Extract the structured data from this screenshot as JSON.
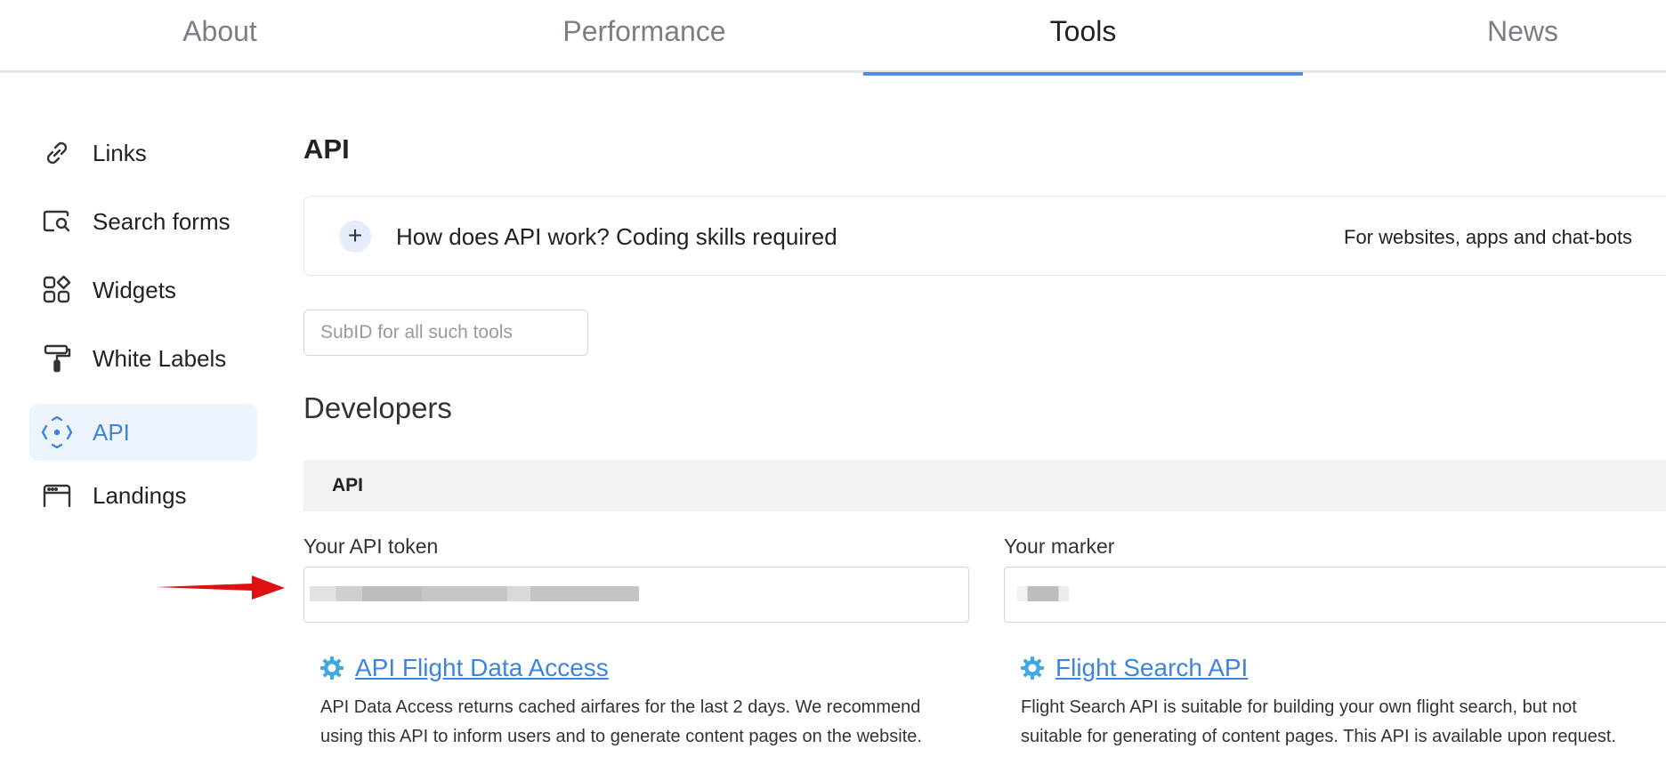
{
  "tabs": [
    {
      "label": "About"
    },
    {
      "label": "Performance"
    },
    {
      "label": "Tools"
    },
    {
      "label": "News"
    }
  ],
  "sidebar": {
    "items": [
      {
        "label": "Links",
        "icon": "link-icon"
      },
      {
        "label": "Search forms",
        "icon": "search-form-icon"
      },
      {
        "label": "Widgets",
        "icon": "widgets-icon"
      },
      {
        "label": "White Labels",
        "icon": "paint-roller-icon"
      },
      {
        "label": "API",
        "icon": "api-icon",
        "active": true
      },
      {
        "label": "Landings",
        "icon": "landing-page-icon"
      }
    ]
  },
  "main": {
    "title": "API",
    "faq": {
      "question": "How does API work? Coding skills required",
      "note": "For websites, apps and chat-bots"
    },
    "subid": {
      "placeholder": "SubID for all such tools",
      "value": ""
    },
    "developers_title": "Developers",
    "section_bar": "API",
    "token_label": "Your API token",
    "marker_label": "Your marker",
    "links": [
      {
        "title": "API Flight Data Access",
        "description_lines": [
          "API Data Access returns cached airfares for the last 2 days. We recommend",
          "using this API to inform users and to generate content pages on the website."
        ]
      },
      {
        "title": "Flight Search API",
        "description_lines": [
          "Flight Search API is suitable for building your own flight search, but not",
          "suitable for generating of content pages. This API is available upon request."
        ]
      }
    ]
  },
  "colors": {
    "accent": "#3d84dc",
    "active_tab_underline": "#4a8fe0",
    "annotation_arrow": "#e01010",
    "gear": "#41a7e0"
  }
}
